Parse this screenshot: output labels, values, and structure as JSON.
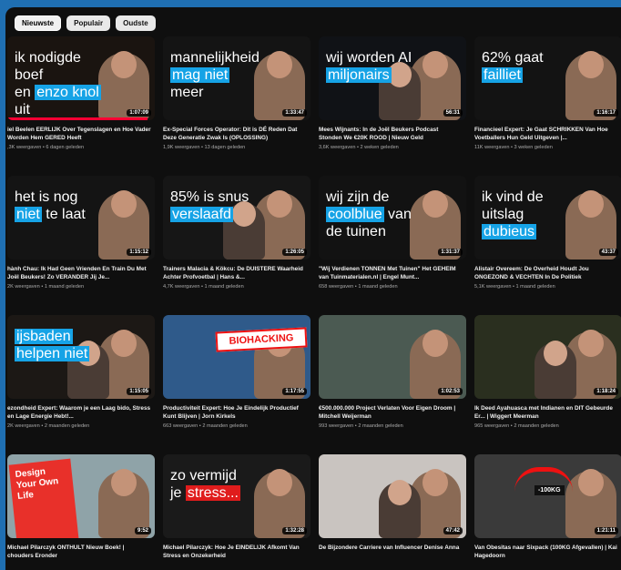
{
  "chips": [
    "Nieuwste",
    "Populair",
    "Oudste"
  ],
  "colors": {
    "frame": "#1f6fb2",
    "background": "#0f0f0f",
    "highlight_blue": "#16a3e6",
    "progress_red": "#ff0033"
  },
  "videos": [
    {
      "thumb_lines": [
        [
          "ik nodigde boef",
          false
        ],
        [
          "en ",
          false
        ],
        [
          "enzo knol",
          true
        ],
        [
          " uit",
          false
        ]
      ],
      "duration": "1:07:09",
      "title": "iel Beelen EERLIJK Over Tegenslagen en Hoe Vader Worden Hem GERED Heeft",
      "meta": ",3K weergaven • 6 dagen geleden",
      "bg": "#1a1410",
      "progress": 0.95
    },
    {
      "thumb_lines": [
        [
          "mannelijkheid",
          false
        ],
        [
          "mag niet",
          true
        ],
        [
          " meer",
          false
        ]
      ],
      "duration": "1:33:47",
      "title": "Ex-Special Forces Operator: Dit is DÉ Reden Dat Deze Generatie Zwak Is (OPLOSSING)",
      "meta": "1,9K weergaven • 13 dagen geleden",
      "bg": "#141414",
      "progress": 0.0
    },
    {
      "thumb_lines": [
        [
          "wij worden AI",
          false
        ],
        [
          "miljonairs",
          true
        ]
      ],
      "duration": "56:31",
      "title": "Mees Wijnants: In de Joël Beukers Podcast Stonden We €20K ROOD | Nieuw Geld",
      "meta": "3,6K weergaven • 2 weken geleden",
      "bg": "#101216",
      "progress": 0.0
    },
    {
      "thumb_lines": [
        [
          "62% gaat",
          false
        ],
        [
          "failliet",
          true
        ]
      ],
      "duration": "1:16:17",
      "title": "Financieel Expert: Je Gaat SCHRIKKEN Van Hoe Voetballers Hun Geld Uitgeven |...",
      "meta": "11K weergaven • 3 weken geleden",
      "bg": "#131313",
      "progress": 0.0
    },
    {
      "thumb_lines": [
        [
          "het is nog",
          false
        ],
        [
          "niet",
          true
        ],
        [
          " te laat",
          false
        ]
      ],
      "duration": "1:15:12",
      "title": "hành Chau: Ik Had Geen Vrienden En Train Du Met Joël Beukers! Zo VERANDER Jij Je...",
      "meta": "2K weergaven • 1 maand geleden",
      "bg": "#141414",
      "progress": 0.0
    },
    {
      "thumb_lines": [
        [
          "85% is snus",
          false
        ],
        [
          "verslaafd",
          true
        ]
      ],
      "duration": "1:26:05",
      "title": "Trainers Malacia & Kökcu: De DUISTERE Waarheid Achter Profvoetbal | Hans &...",
      "meta": "4,7K weergaven • 1 maand geleden",
      "bg": "#161616",
      "progress": 0.0
    },
    {
      "thumb_lines": [
        [
          "wij zijn de",
          false
        ],
        [
          "coolblue",
          true
        ],
        [
          " van",
          false
        ],
        [
          "de tuinen",
          false
        ]
      ],
      "duration": "1:31:37",
      "title": "\"Wij Verdienen TONNEN Met Tuinen\" Het GEHEIM van Tuinmaterialen.nl | Engel Munt...",
      "meta": "658 weergaven • 1 maand geleden",
      "bg": "#121212",
      "progress": 0.0
    },
    {
      "thumb_lines": [
        [
          "ik vind de",
          false
        ],
        [
          "uitslag",
          false
        ],
        [
          "dubieus",
          true
        ]
      ],
      "duration": "43:37",
      "title": "Alistair Overeem: De Overheid Houdt Jou ONGEZOND & VECHTEN In De Politiek",
      "meta": "5,1K weergaven • 1 maand geleden",
      "bg": "#131313",
      "progress": 0.0
    },
    {
      "thumb_lines": [
        [
          "ijsbaden",
          true
        ],
        [
          "helpen niet",
          true
        ]
      ],
      "duration": "1:15:05",
      "title": "ezondheid Expert: Waarom je een Laag bido, Stress en Lage Energie Hebt!...",
      "meta": "2K weergaven • 2 maanden geleden",
      "bg": "#1c1815",
      "progress": 0.0
    },
    {
      "thumb_lines": [],
      "extra": "BIOHACKING",
      "duration": "1:17:55",
      "title": "Productiviteit Expert: Hoe Je Eindelijk Productief Kunt Blijven | Jorn Kirkels",
      "meta": "663 weergaven • 2 maanden geleden",
      "bg": "#2f5a8a",
      "progress": 0.0
    },
    {
      "thumb_lines": [],
      "duration": "1:02:53",
      "title": "€500.000.000 Project Verlaten Voor Eigen Droom | Mitchell Weijerman",
      "meta": "993 weergaven • 2 maanden geleden",
      "bg": "#4b5a52",
      "progress": 0.0
    },
    {
      "thumb_lines": [],
      "duration": "1:18:24",
      "title": "Ik Deed Ayahuasca met Indianen en DIT Gebeurde Er... | Wiggert Meerman",
      "meta": "965 weergaven • 2 maanden geleden",
      "bg": "#2a2f1f",
      "progress": 0.0
    },
    {
      "thumb_lines": [],
      "book": "Design Your Own Life",
      "duration": "9:52",
      "title": "Michael Pilarczyk ONTHULT Nieuw Boek! | chouders Eronder",
      "meta": "",
      "bg": "#8fa3a8",
      "progress": 0.0
    },
    {
      "thumb_lines": [
        [
          "zo vermijd",
          false
        ],
        [
          "je ",
          false
        ],
        [
          "stress...",
          true,
          true
        ]
      ],
      "duration": "1:32:28",
      "title": "Michael Pilarczyk: Hoe Je EINDELIJK Afkomt Van Stress en Onzekerheid",
      "meta": "",
      "bg": "#1a1a1a",
      "progress": 0.0
    },
    {
      "thumb_lines": [],
      "duration": "47:42",
      "title": "De Bijzondere Carriere van Influencer Denise Anna",
      "meta": "",
      "bg": "#c9c4c0",
      "progress": 0.0
    },
    {
      "thumb_lines": [],
      "kg": "-100KG",
      "duration": "1:21:11",
      "title": "Van Obesitas naar Sixpack (100KG Afgevallen) | Kai Hagedoorn",
      "meta": "",
      "bg": "#3a3a3a",
      "progress": 0.0
    }
  ]
}
